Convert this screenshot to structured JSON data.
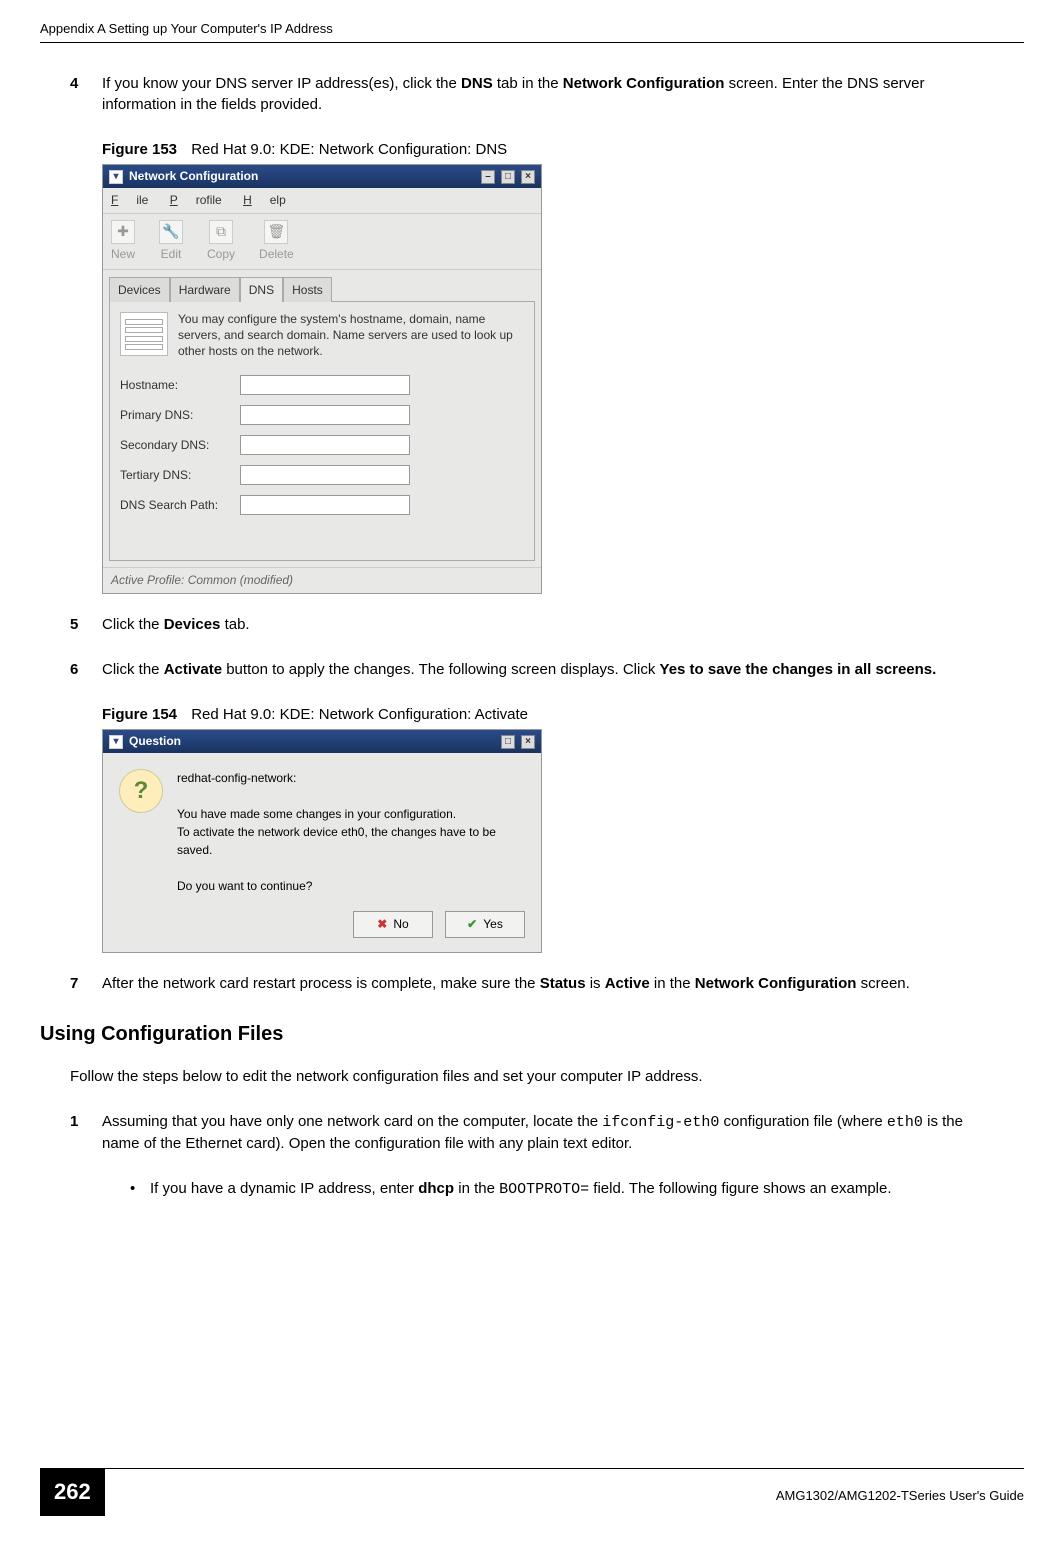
{
  "header": {
    "running_head": "Appendix A Setting up Your Computer's IP Address"
  },
  "steps": {
    "s4": {
      "num": "4",
      "pre": "If you know your DNS server IP address(es), click the ",
      "b1": "DNS",
      "mid": " tab in the ",
      "b2": "Network Configuration",
      "post": " screen. Enter the DNS server information in the fields provided."
    },
    "s5": {
      "num": "5",
      "pre": "Click the ",
      "b1": "Devices",
      "post": " tab."
    },
    "s6": {
      "num": "6",
      "pre": "Click the ",
      "b1": "Activate",
      "mid": " button to apply the changes. The following screen displays. Click ",
      "b2": "Yes to save the changes in all screens."
    },
    "s7": {
      "num": "7",
      "pre": "After the network card restart process is complete, make sure the ",
      "b1": "Status",
      "mid": " is ",
      "b2": "Active",
      "mid2": " in the ",
      "b3": "Network Configuration",
      "post": " screen."
    },
    "s1b": {
      "num": "1",
      "pre": "Assuming that you have only one network card on the computer, locate the ",
      "code1": "ifconfig-eth0",
      "mid": " configuration file (where ",
      "code2": "eth0",
      "post": " is the name of the Ethernet card). Open the configuration file with any plain text editor."
    },
    "bullet": {
      "dot": "•",
      "pre": "If you have a dynamic IP address, enter ",
      "b1": "dhcp",
      "mid": " in the ",
      "code1": "BOOTPROTO=",
      "post": " field. The following figure shows an example."
    }
  },
  "fig153": {
    "label": "Figure 153",
    "caption": "Red Hat 9.0: KDE: Network Configuration: DNS",
    "title": "Network Configuration",
    "menu": {
      "file": "File",
      "profile": "Profile",
      "help": "Help"
    },
    "toolbar": {
      "new": "New",
      "edit": "Edit",
      "copy": "Copy",
      "delete": "Delete"
    },
    "tabs": {
      "devices": "Devices",
      "hardware": "Hardware",
      "dns": "DNS",
      "hosts": "Hosts"
    },
    "desc": "You may configure the system's hostname, domain, name servers, and search domain. Name servers are used to look up other hosts on the network.",
    "labels": {
      "hostname": "Hostname:",
      "primary": "Primary DNS:",
      "secondary": "Secondary DNS:",
      "tertiary": "Tertiary DNS:",
      "searchpath": "DNS Search Path:"
    },
    "status": "Active Profile: Common (modified)"
  },
  "fig154": {
    "label": "Figure 154",
    "caption": "Red Hat 9.0: KDE: Network Configuration: Activate",
    "title": "Question",
    "line1": "redhat-config-network:",
    "line2": "You have made some changes in your configuration.",
    "line3": "To activate the network device eth0, the changes have to be saved.",
    "line4": "Do you want to continue?",
    "no": "No",
    "yes": "Yes"
  },
  "section": {
    "heading": "Using Configuration Files",
    "intro": "Follow the steps below to edit the network configuration files and set your computer IP address."
  },
  "footer": {
    "page": "262",
    "guide": "AMG1302/AMG1202-TSeries User's Guide"
  }
}
